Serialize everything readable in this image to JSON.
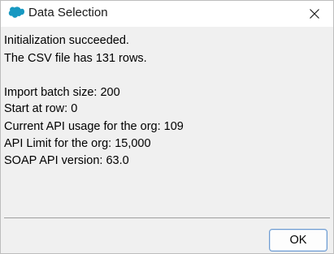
{
  "window": {
    "title": "Data Selection",
    "icon": "salesforce-cloud-icon",
    "accent_color": "#1798c1"
  },
  "message": {
    "status_line": "Initialization succeeded.",
    "rows_line": "The CSV file has 131 rows.",
    "batch_size_line": "Import batch size: 200",
    "start_row_line": "Start at row: 0",
    "api_usage_line": "Current API usage for the org: 109",
    "api_limit_line": "API Limit for the org: 15,000",
    "soap_version_line": "SOAP API version: 63.0"
  },
  "buttons": {
    "ok_label": "OK",
    "close_icon": "close-icon"
  }
}
